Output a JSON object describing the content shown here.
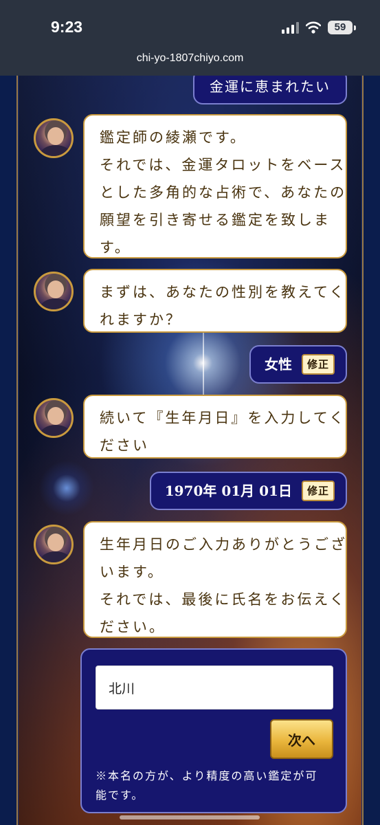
{
  "status_bar": {
    "time": "9:23",
    "battery": "59"
  },
  "browser": {
    "url": "chi-yo-1807chiyo.com"
  },
  "chat": {
    "previous_user_reply": "金運に恵まれたい",
    "messages": [
      {
        "lines": [
          "鑑定師の綾瀬です。",
          "それでは、金運タロットをベース",
          "とした多角的な占術で、あなたの",
          "願望を引き寄せる鑑定を致しま",
          "す。"
        ]
      },
      {
        "lines": [
          "まずは、あなたの性別を教えてく",
          "れますか？"
        ]
      },
      {
        "lines": [
          "続いて『生年月日』を入力してく",
          "ださい"
        ]
      },
      {
        "lines": [
          "生年月日のご入力ありがとうござ",
          "います。",
          "それでは、最後に氏名をお伝えく",
          "ださい。"
        ]
      }
    ],
    "replies": {
      "gender": "女性",
      "birthdate": "1970年 01月 01日",
      "edit_label": "修正"
    }
  },
  "name_form": {
    "value": "北川",
    "next_label": "次へ",
    "note_lines": [
      "※本名の方が、より精度の高い鑑定が可",
      "能です。"
    ]
  }
}
